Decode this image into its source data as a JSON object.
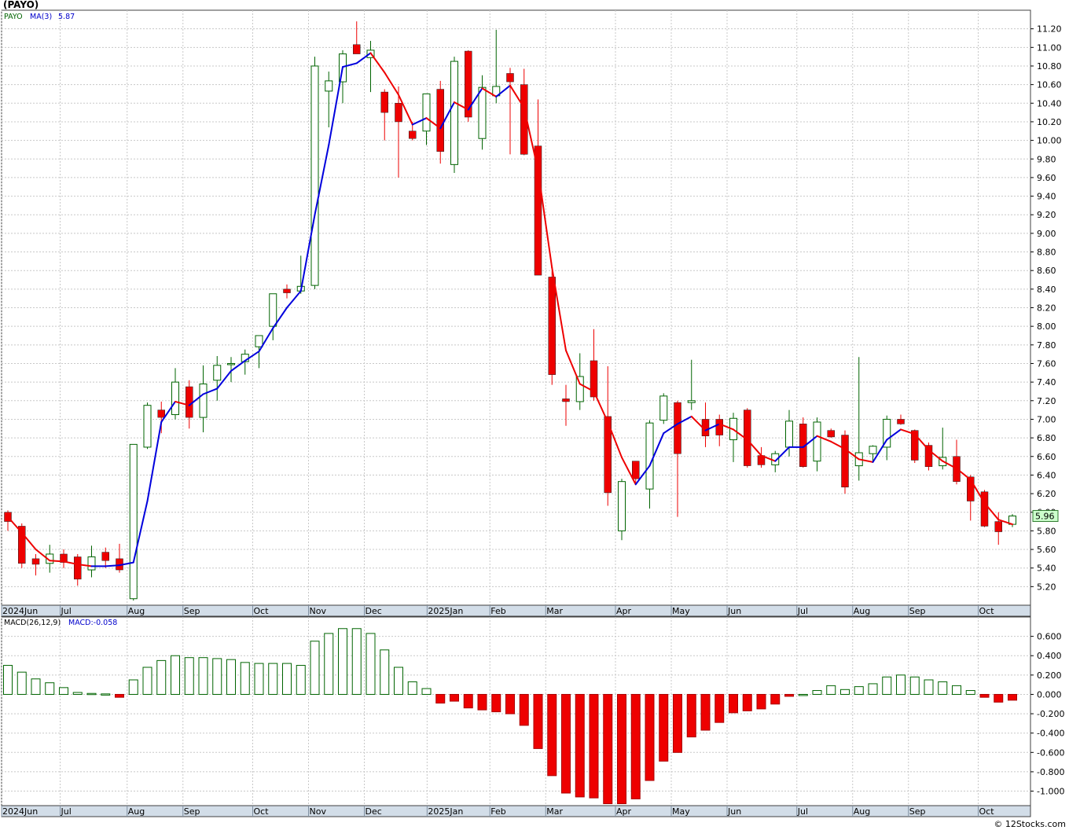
{
  "chart_data": [
    {
      "type": "candlestick",
      "title": "(PAYO)",
      "symbol": "PAYO",
      "ma_label": "MA(3)",
      "ma_value": "5.87",
      "last_price_label": "5.96",
      "y_ticks": [
        "5.20",
        "5.40",
        "5.60",
        "5.80",
        "6.00",
        "6.20",
        "6.40",
        "6.60",
        "6.80",
        "7.00",
        "7.20",
        "7.40",
        "7.60",
        "7.80",
        "8.00",
        "8.20",
        "8.40",
        "8.60",
        "8.80",
        "9.00",
        "9.20",
        "9.40",
        "9.60",
        "9.80",
        "10.00",
        "10.20",
        "10.40",
        "10.60",
        "10.80",
        "11.00",
        "11.20"
      ],
      "y_range": [
        5.0,
        11.4
      ],
      "x_labels": [
        {
          "label": "2024Jun",
          "week": 0
        },
        {
          "label": "Jul",
          "week": 4.2
        },
        {
          "label": "Aug",
          "week": 9
        },
        {
          "label": "Sep",
          "week": 13
        },
        {
          "label": "Oct",
          "week": 18
        },
        {
          "label": "Nov",
          "week": 22
        },
        {
          "label": "Dec",
          "week": 26
        },
        {
          "label": "2025Jan",
          "week": 30.5
        },
        {
          "label": "Feb",
          "week": 35
        },
        {
          "label": "Mar",
          "week": 39
        },
        {
          "label": "Apr",
          "week": 44
        },
        {
          "label": "May",
          "week": 48
        },
        {
          "label": "Jun",
          "week": 52
        },
        {
          "label": "Jul",
          "week": 57
        },
        {
          "label": "Aug",
          "week": 61
        },
        {
          "label": "Sep",
          "week": 65
        },
        {
          "label": "Oct",
          "week": 70
        }
      ],
      "candles": [
        {
          "o": 6.0,
          "h": 6.02,
          "l": 5.8,
          "c": 5.9
        },
        {
          "o": 5.85,
          "h": 5.88,
          "l": 5.4,
          "c": 5.45
        },
        {
          "o": 5.5,
          "h": 5.55,
          "l": 5.32,
          "c": 5.44
        },
        {
          "o": 5.45,
          "h": 5.65,
          "l": 5.35,
          "c": 5.55
        },
        {
          "o": 5.55,
          "h": 5.6,
          "l": 5.4,
          "c": 5.46
        },
        {
          "o": 5.52,
          "h": 5.55,
          "l": 5.21,
          "c": 5.28
        },
        {
          "o": 5.38,
          "h": 5.64,
          "l": 5.3,
          "c": 5.52
        },
        {
          "o": 5.57,
          "h": 5.62,
          "l": 5.4,
          "c": 5.48
        },
        {
          "o": 5.5,
          "h": 5.66,
          "l": 5.35,
          "c": 5.38
        },
        {
          "o": 5.07,
          "h": 5.1,
          "l": 5.05,
          "c": 6.73
        },
        {
          "o": 6.7,
          "h": 7.18,
          "l": 6.68,
          "c": 7.15
        },
        {
          "o": 7.1,
          "h": 7.19,
          "l": 6.85,
          "c": 7.02
        },
        {
          "o": 7.05,
          "h": 7.55,
          "l": 7.0,
          "c": 7.4
        },
        {
          "o": 7.35,
          "h": 7.42,
          "l": 6.9,
          "c": 7.02
        },
        {
          "o": 7.02,
          "h": 7.58,
          "l": 6.86,
          "c": 7.38
        },
        {
          "o": 7.42,
          "h": 7.68,
          "l": 7.2,
          "c": 7.58
        },
        {
          "o": 7.6,
          "h": 7.67,
          "l": 7.4,
          "c": 7.6
        },
        {
          "o": 7.62,
          "h": 7.75,
          "l": 7.48,
          "c": 7.7
        },
        {
          "o": 7.78,
          "h": 7.88,
          "l": 7.55,
          "c": 7.9
        },
        {
          "o": 8.0,
          "h": 8.35,
          "l": 7.85,
          "c": 8.35
        },
        {
          "o": 8.4,
          "h": 8.45,
          "l": 8.3,
          "c": 8.36
        },
        {
          "o": 8.38,
          "h": 8.76,
          "l": 8.35,
          "c": 8.43
        },
        {
          "o": 8.44,
          "h": 10.9,
          "l": 8.4,
          "c": 10.8
        },
        {
          "o": 10.53,
          "h": 10.74,
          "l": 10.14,
          "c": 10.64
        },
        {
          "o": 10.63,
          "h": 10.97,
          "l": 10.4,
          "c": 10.93
        },
        {
          "o": 11.03,
          "h": 11.28,
          "l": 10.96,
          "c": 10.93
        },
        {
          "o": 10.89,
          "h": 11.07,
          "l": 10.52,
          "c": 10.97
        },
        {
          "o": 10.52,
          "h": 10.55,
          "l": 10.0,
          "c": 10.3
        },
        {
          "o": 10.4,
          "h": 10.58,
          "l": 9.6,
          "c": 10.2
        },
        {
          "o": 10.1,
          "h": 10.2,
          "l": 10.0,
          "c": 10.02
        },
        {
          "o": 10.1,
          "h": 10.5,
          "l": 9.95,
          "c": 10.5
        },
        {
          "o": 10.55,
          "h": 10.64,
          "l": 9.75,
          "c": 9.88
        },
        {
          "o": 9.74,
          "h": 10.9,
          "l": 9.65,
          "c": 10.85
        },
        {
          "o": 10.96,
          "h": 10.97,
          "l": 10.2,
          "c": 10.25
        },
        {
          "o": 10.02,
          "h": 10.7,
          "l": 9.9,
          "c": 10.57
        },
        {
          "o": 10.48,
          "h": 11.19,
          "l": 10.4,
          "c": 10.58
        },
        {
          "o": 10.72,
          "h": 10.78,
          "l": 9.85,
          "c": 10.63
        },
        {
          "o": 10.6,
          "h": 10.77,
          "l": 9.84,
          "c": 9.85
        },
        {
          "o": 9.94,
          "h": 10.44,
          "l": 8.7,
          "c": 8.55
        },
        {
          "o": 8.53,
          "h": 8.6,
          "l": 7.37,
          "c": 7.48
        },
        {
          "o": 7.22,
          "h": 7.37,
          "l": 6.93,
          "c": 7.19
        },
        {
          "o": 7.19,
          "h": 7.71,
          "l": 7.1,
          "c": 7.46
        },
        {
          "o": 7.63,
          "h": 7.97,
          "l": 7.2,
          "c": 7.24
        },
        {
          "o": 7.03,
          "h": 7.57,
          "l": 6.07,
          "c": 6.21
        },
        {
          "o": 5.8,
          "h": 6.36,
          "l": 5.7,
          "c": 6.33
        },
        {
          "o": 6.55,
          "h": 6.55,
          "l": 6.3,
          "c": 6.36
        },
        {
          "o": 6.25,
          "h": 6.99,
          "l": 6.04,
          "c": 6.96
        },
        {
          "o": 6.99,
          "h": 7.28,
          "l": 6.95,
          "c": 7.25
        },
        {
          "o": 7.18,
          "h": 7.2,
          "l": 5.95,
          "c": 6.63
        },
        {
          "o": 7.18,
          "h": 7.64,
          "l": 7.1,
          "c": 7.2
        },
        {
          "o": 7.0,
          "h": 7.18,
          "l": 6.7,
          "c": 6.82
        },
        {
          "o": 7.0,
          "h": 7.05,
          "l": 6.71,
          "c": 6.83
        },
        {
          "o": 6.78,
          "h": 7.07,
          "l": 6.54,
          "c": 7.01
        },
        {
          "o": 7.1,
          "h": 7.12,
          "l": 6.48,
          "c": 6.5
        },
        {
          "o": 6.61,
          "h": 6.7,
          "l": 6.48,
          "c": 6.51
        },
        {
          "o": 6.51,
          "h": 6.66,
          "l": 6.43,
          "c": 6.63
        },
        {
          "o": 6.7,
          "h": 7.1,
          "l": 6.6,
          "c": 6.98
        },
        {
          "o": 6.95,
          "h": 7.02,
          "l": 6.48,
          "c": 6.49
        },
        {
          "o": 6.55,
          "h": 7.02,
          "l": 6.44,
          "c": 6.97
        },
        {
          "o": 6.88,
          "h": 6.9,
          "l": 6.8,
          "c": 6.81
        },
        {
          "o": 6.83,
          "h": 6.88,
          "l": 6.2,
          "c": 6.27
        },
        {
          "o": 6.5,
          "h": 7.67,
          "l": 6.34,
          "c": 6.64
        },
        {
          "o": 6.63,
          "h": 6.72,
          "l": 6.55,
          "c": 6.71
        },
        {
          "o": 6.7,
          "h": 7.04,
          "l": 6.56,
          "c": 7.0
        },
        {
          "o": 7.0,
          "h": 7.05,
          "l": 6.94,
          "c": 6.95
        },
        {
          "o": 6.88,
          "h": 6.89,
          "l": 6.53,
          "c": 6.56
        },
        {
          "o": 6.72,
          "h": 6.75,
          "l": 6.45,
          "c": 6.49
        },
        {
          "o": 6.5,
          "h": 6.91,
          "l": 6.46,
          "c": 6.59
        },
        {
          "o": 6.6,
          "h": 6.78,
          "l": 6.3,
          "c": 6.33
        },
        {
          "o": 6.38,
          "h": 6.4,
          "l": 5.91,
          "c": 6.12
        },
        {
          "o": 6.22,
          "h": 6.24,
          "l": 5.84,
          "c": 5.85
        },
        {
          "o": 5.9,
          "h": 6.0,
          "l": 5.65,
          "c": 5.79
        },
        {
          "o": 5.87,
          "h": 5.98,
          "l": 5.84,
          "c": 5.96
        }
      ],
      "ma3": [
        5.95,
        5.78,
        5.6,
        5.48,
        5.47,
        5.44,
        5.42,
        5.42,
        5.43,
        5.46,
        6.12,
        6.97,
        7.19,
        7.15,
        7.27,
        7.33,
        7.52,
        7.63,
        7.73,
        7.98,
        8.2,
        8.38,
        9.2,
        9.95,
        10.79,
        10.83,
        10.94,
        10.73,
        10.49,
        10.17,
        10.24,
        10.13,
        10.41,
        10.33,
        10.56,
        10.47,
        10.59,
        10.35,
        9.68,
        8.63,
        7.74,
        7.38,
        7.3,
        6.97,
        6.59,
        6.3,
        6.5,
        6.85,
        6.95,
        7.03,
        6.88,
        6.95,
        6.89,
        6.78,
        6.61,
        6.55,
        6.7,
        6.7,
        6.82,
        6.76,
        6.68,
        6.57,
        6.54,
        6.78,
        6.89,
        6.84,
        6.67,
        6.55,
        6.47,
        6.35,
        6.1,
        5.92,
        5.87
      ],
      "ma_colors": {
        "up": "#0000dd",
        "down": "#ee0000"
      }
    },
    {
      "type": "bar",
      "title": "MACD(26,12,9)",
      "value_label": "MACD:-0.058",
      "y_ticks": [
        "-1.000",
        "-0.800",
        "-0.600",
        "-0.400",
        "-0.200",
        "0.000",
        "0.200",
        "0.400",
        "0.600"
      ],
      "y_range": [
        -1.15,
        0.8
      ],
      "values": [
        0.3,
        0.23,
        0.16,
        0.12,
        0.07,
        0.02,
        0.01,
        0.005,
        -0.03,
        0.15,
        0.28,
        0.35,
        0.4,
        0.38,
        0.38,
        0.37,
        0.36,
        0.33,
        0.32,
        0.32,
        0.32,
        0.3,
        0.55,
        0.63,
        0.68,
        0.68,
        0.63,
        0.46,
        0.28,
        0.13,
        0.06,
        -0.09,
        -0.07,
        -0.14,
        -0.16,
        -0.18,
        -0.2,
        -0.32,
        -0.56,
        -0.84,
        -1.02,
        -1.06,
        -1.07,
        -1.13,
        -1.13,
        -1.08,
        -0.89,
        -0.69,
        -0.6,
        -0.44,
        -0.37,
        -0.29,
        -0.19,
        -0.17,
        -0.15,
        -0.1,
        -0.02,
        0.0,
        0.04,
        0.09,
        0.05,
        0.08,
        0.11,
        0.18,
        0.2,
        0.18,
        0.15,
        0.13,
        0.09,
        0.04,
        -0.03,
        -0.08,
        -0.06
      ]
    }
  ],
  "footer": {
    "copyright": "© 12Stocks.com"
  },
  "colors": {
    "up": "#006400",
    "down": "#ee0000",
    "panel_border": "#404040",
    "axis_bar": "#d2dde8",
    "badge_fill": "#ccffcc"
  }
}
